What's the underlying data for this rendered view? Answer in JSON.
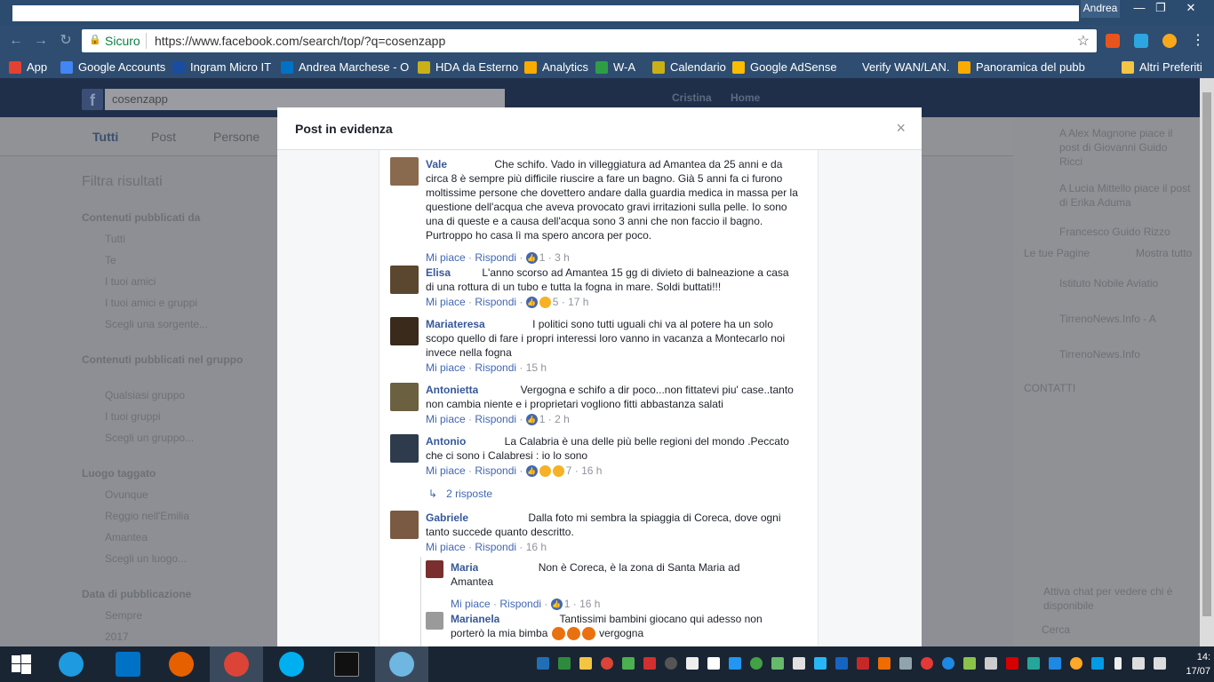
{
  "window": {
    "user": "Andrea",
    "min": "—",
    "max": "❐",
    "close": "✕"
  },
  "toolbar": {
    "secure_label": "Sicuro",
    "url": "https://www.facebook.com/search/top/?q=cosenzapp"
  },
  "bookmarks": [
    {
      "label": "App",
      "color": "#e34133"
    },
    {
      "label": "Google Accounts",
      "color": "#4285f4"
    },
    {
      "label": "Ingram Micro IT",
      "color": "#1a4da1"
    },
    {
      "label": "Andrea Marchese - O",
      "color": "#0072c6"
    },
    {
      "label": "HDA da Esterno",
      "color": "#c9b017"
    },
    {
      "label": "Analytics",
      "color": "#f9ab00"
    },
    {
      "label": "W-A",
      "color": "#2e9e44"
    },
    {
      "label": "Calendario",
      "color": "#c9b017"
    },
    {
      "label": "Google AdSense",
      "color": "#fbbc04"
    },
    {
      "label": "Verify WAN/LAN.",
      "color": "#2e4d70"
    },
    {
      "label": "Panoramica del pubb",
      "color": "#f9ab00"
    },
    {
      "label": "Altri Preferiti",
      "color": "#f4c542"
    }
  ],
  "fb": {
    "search_value": "cosenzapp",
    "user_name": "Cristina",
    "home": "Home",
    "tabs": [
      "Tutti",
      "Post",
      "Persone"
    ],
    "left": {
      "filter_title": "Filtra risultati",
      "sec1": "Contenuti pubblicati da",
      "sec1_items": [
        "Tutti",
        "Te",
        "I tuoi amici",
        "I tuoi amici e gruppi",
        "Scegli una sorgente..."
      ],
      "sec2": "Contenuti pubblicati nel gruppo",
      "sec2_items": [
        "Qualsiasi gruppo",
        "I tuoi gruppi",
        "Scegli un gruppo..."
      ],
      "sec3": "Luogo taggato",
      "sec3_items": [
        "Ovunque",
        "Reggio nell'Emilia",
        "Amantea",
        "Scegli un luogo..."
      ],
      "sec4": "Data di pubblicazione",
      "sec4_items": [
        "Sempre",
        "2017"
      ]
    },
    "right": {
      "activity": [
        "A Alex Magnone piace il post di Giovanni Guido Ricci",
        "A Lucia Mittello piace il post di Erika Aduma",
        "Francesco Guido Rizzo"
      ],
      "pages_title": "Le tue Pagine",
      "pages_more": "Mostra tutto",
      "pages": [
        "Istituto Nobile Aviatio",
        "TirrenoNews.Info - A",
        "TirrenoNews.Info"
      ],
      "contacts": "CONTATTI",
      "chat_hint": "Attiva chat per vedere chi è disponibile",
      "search": "Cerca"
    }
  },
  "modal": {
    "title": "Post in evidenza",
    "close": "×",
    "like": "Mi piace",
    "reply": "Rispondi",
    "replies_link": "2 risposte",
    "comments": [
      {
        "name": "Vale",
        "text": "Che schifo. Vado in villeggiatura ad Amantea da 25 anni e da circa 8 è sempre più difficile riuscire a fare un bagno. Già 5 anni fa ci furono moltissime persone che dovettero andare dalla guardia medica in massa per la questione dell'acqua che aveva provocato gravi irritazioni sulla pelle. Io sono una di queste e a causa dell'acqua sono 3 anni che non faccio il bagno. Purtroppo ho casa lì ma spero ancora per poco.",
        "count": "1",
        "time": "3 h",
        "avatar_color": "#8a6a4f"
      },
      {
        "name": "Elisa",
        "text": "L'anno scorso ad Amantea 15 gg di divieto di balneazione a casa di una rottura di un tubo e tutta la fogna in mare. Soldi buttati!!!",
        "count": "5",
        "time": "17 h",
        "avatar_color": "#5b4630"
      },
      {
        "name": "Mariateresa",
        "text": "I politici sono tutti uguali chi va al potere ha un solo scopo quello di fare i propri interessi loro vanno in vacanza a Montecarlo noi invece nella fogna",
        "count": "",
        "time": "15 h",
        "avatar_color": "#3a2a1c"
      },
      {
        "name": "Antonietta",
        "text": "Vergogna e schifo a dir poco...non fittatevi piu' case..tanto non cambia niente e i proprietari vogliono fitti abbastanza salati",
        "count": "1",
        "time": "2 h",
        "avatar_color": "#6b6040"
      },
      {
        "name": "Antonio",
        "text": "La Calabria è una delle più belle regioni del mondo .Peccato che ci sono i Calabresi : io lo sono",
        "count": "7",
        "time": "16 h",
        "avatar_color": "#2d3b4c"
      },
      {
        "name": "Gabriele",
        "text": "Dalla foto mi sembra la spiaggia di Coreca, dove ogni tanto succede quanto descritto.",
        "count": "",
        "time": "16 h",
        "avatar_color": "#7a5a42"
      }
    ],
    "replies": [
      {
        "name": "Maria",
        "text": "Non è Coreca, è la zona di Santa Maria ad Amantea",
        "count": "1",
        "time": "16 h",
        "avatar_color": "#7a2f2f"
      },
      {
        "name": "Marianela",
        "text_a": "Tantissimi bambini giocano qui adesso non porterò la mia bimba",
        "text_b": "vergogna",
        "avatar_color": "#9a9a9a"
      }
    ]
  },
  "clock": {
    "time": "14:",
    "date": "17/07"
  }
}
